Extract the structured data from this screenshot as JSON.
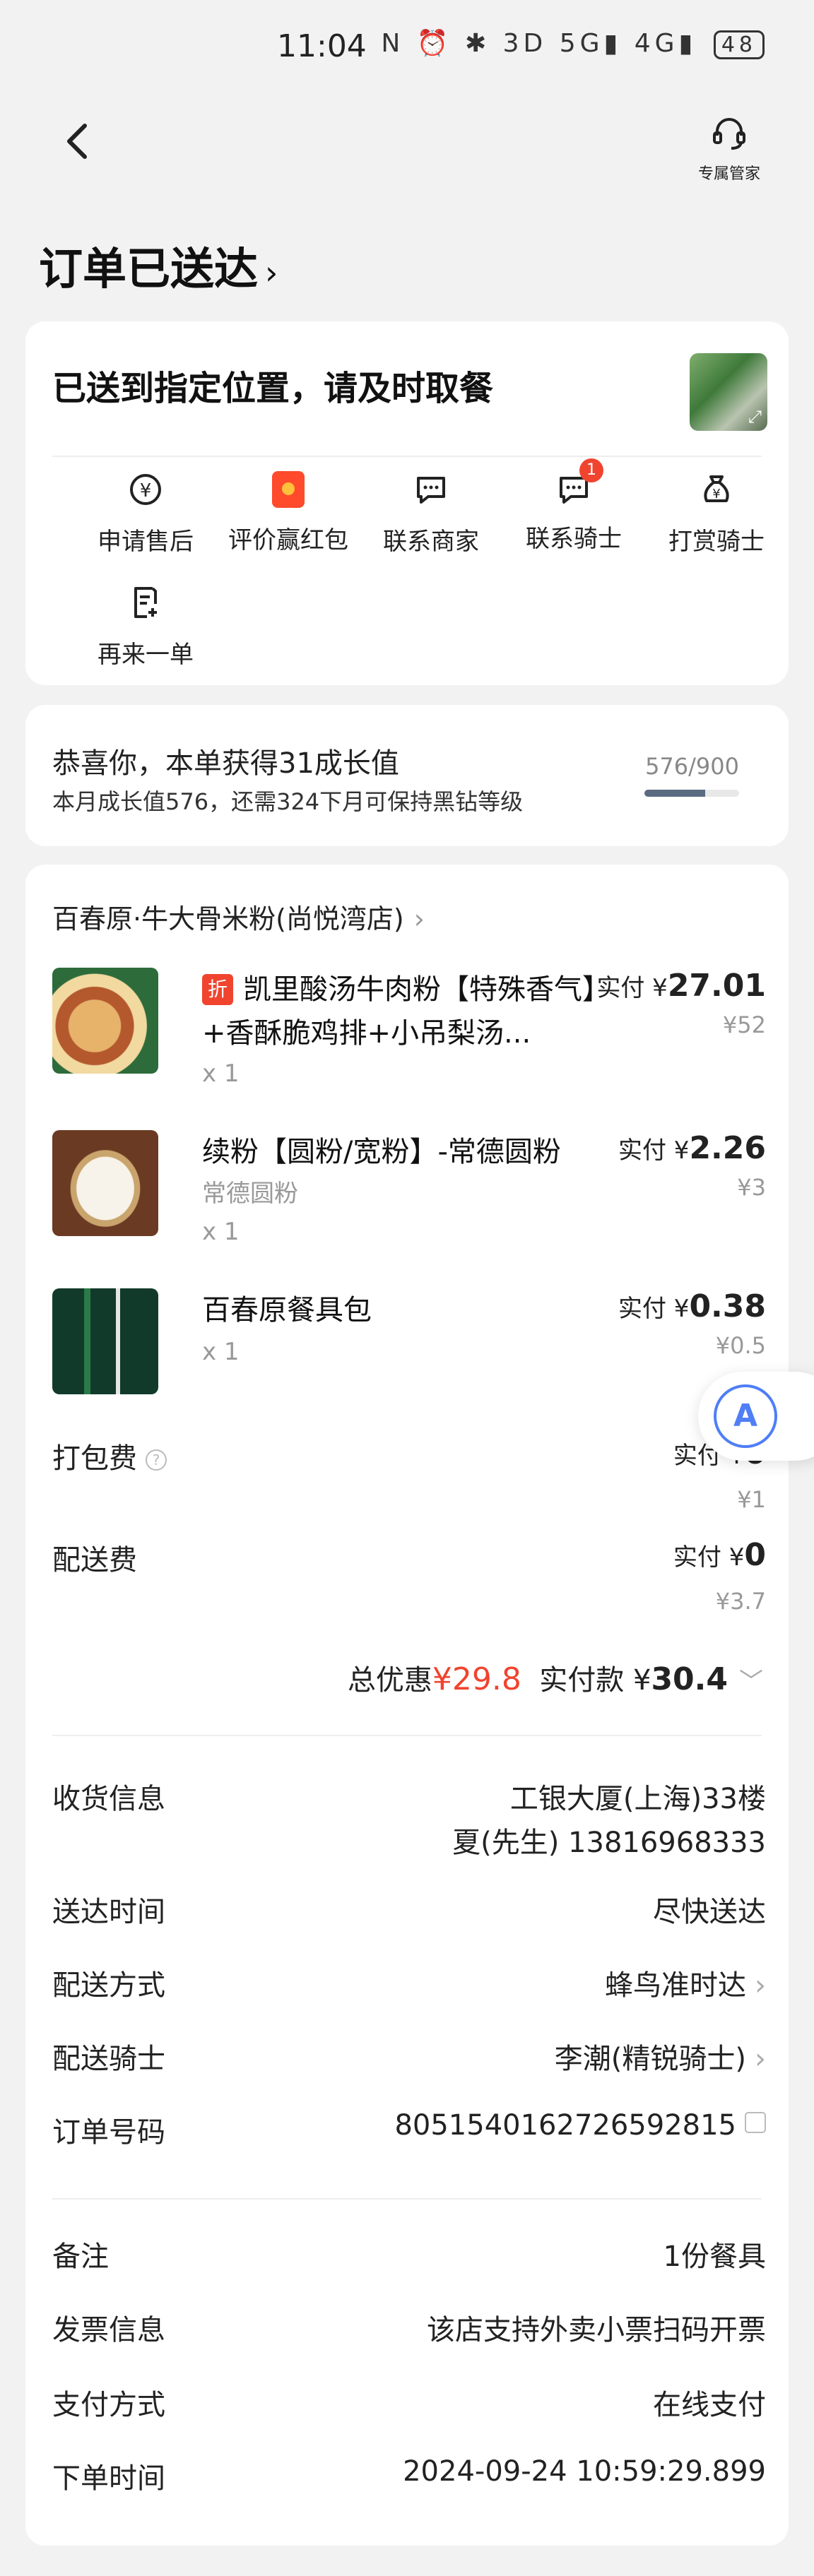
{
  "status_bar": {
    "time": "11:04",
    "signal": "N ⏰ ✱ 3D 5G▮ 4G▮",
    "battery": "48"
  },
  "header": {
    "manager_label": "专属管家"
  },
  "page_title": "订单已送达",
  "status_card": {
    "headline": "已送到指定位置，请及时取餐",
    "actions": [
      {
        "label": "申请售后",
        "icon": "refund-icon"
      },
      {
        "label": "评价赢红包",
        "icon": "red-envelope-icon"
      },
      {
        "label": "联系商家",
        "icon": "chat-icon"
      },
      {
        "label": "联系骑士",
        "icon": "chat-icon",
        "badge": "1"
      },
      {
        "label": "打赏骑士",
        "icon": "money-bag-icon"
      },
      {
        "label": "再来一单",
        "icon": "reorder-icon"
      }
    ]
  },
  "growth": {
    "text1": "恭喜你，本单获得31成长值",
    "text2": "本月成长值576，还需324下月可保持黑钻等级",
    "progress_text": "576/900",
    "progress_value": 0.64
  },
  "order": {
    "shop_name": "百春原·牛大骨米粉(尚悦湾店)",
    "items": [
      {
        "tag": "折",
        "name": "凯里酸汤牛肉粉【特殊香气】+香酥脆鸡排+小吊梨汤...",
        "qty": "x 1",
        "paid_label": "实付 ¥",
        "paid": "27.01",
        "orig": "¥52"
      },
      {
        "name": "续粉【圆粉/宽粉】-常德圆粉",
        "sub": "常德圆粉",
        "qty": "x 1",
        "paid_label": "实付 ¥",
        "paid": "2.26",
        "orig": "¥3"
      },
      {
        "name": "百春原餐具包",
        "qty": "x 1",
        "paid_label": "实付 ¥",
        "paid": "0.38",
        "orig": "¥0.5"
      }
    ],
    "fees": [
      {
        "label": "打包费",
        "paid_label": "实付 ¥",
        "paid": "0",
        "orig": "¥1"
      },
      {
        "label": "配送费",
        "paid_label": "实付 ¥",
        "paid": "0",
        "orig": "¥3.7"
      }
    ],
    "total": {
      "discount_label": "总优惠",
      "discount": "¥29.8",
      "paid_label": "实付款 ¥",
      "paid": "30.4"
    },
    "info1": [
      {
        "key": "收货信息",
        "value": "工银大厦(上海)33楼",
        "value2": "夏(先生) 13816968333"
      },
      {
        "key": "送达时间",
        "value": "尽快送达"
      },
      {
        "key": "配送方式",
        "value": "蜂鸟准时达"
      },
      {
        "key": "配送骑士",
        "value": "李潮(精锐骑士)"
      },
      {
        "key": "订单号码",
        "value": "8051540162726592815"
      }
    ],
    "info2": [
      {
        "key": "备注",
        "value": "1份餐具"
      },
      {
        "key": "发票信息",
        "value": "该店支持外卖小票扫码开票"
      },
      {
        "key": "支付方式",
        "value": "在线支付"
      },
      {
        "key": "下单时间",
        "value": "2024-09-24 10:59:29.899"
      }
    ]
  },
  "floating_button": {
    "icon": "translate-icon",
    "glyph": "A"
  },
  "colors": {
    "accent_red": "#f0442f",
    "page_bg": "#f2f2f2"
  }
}
